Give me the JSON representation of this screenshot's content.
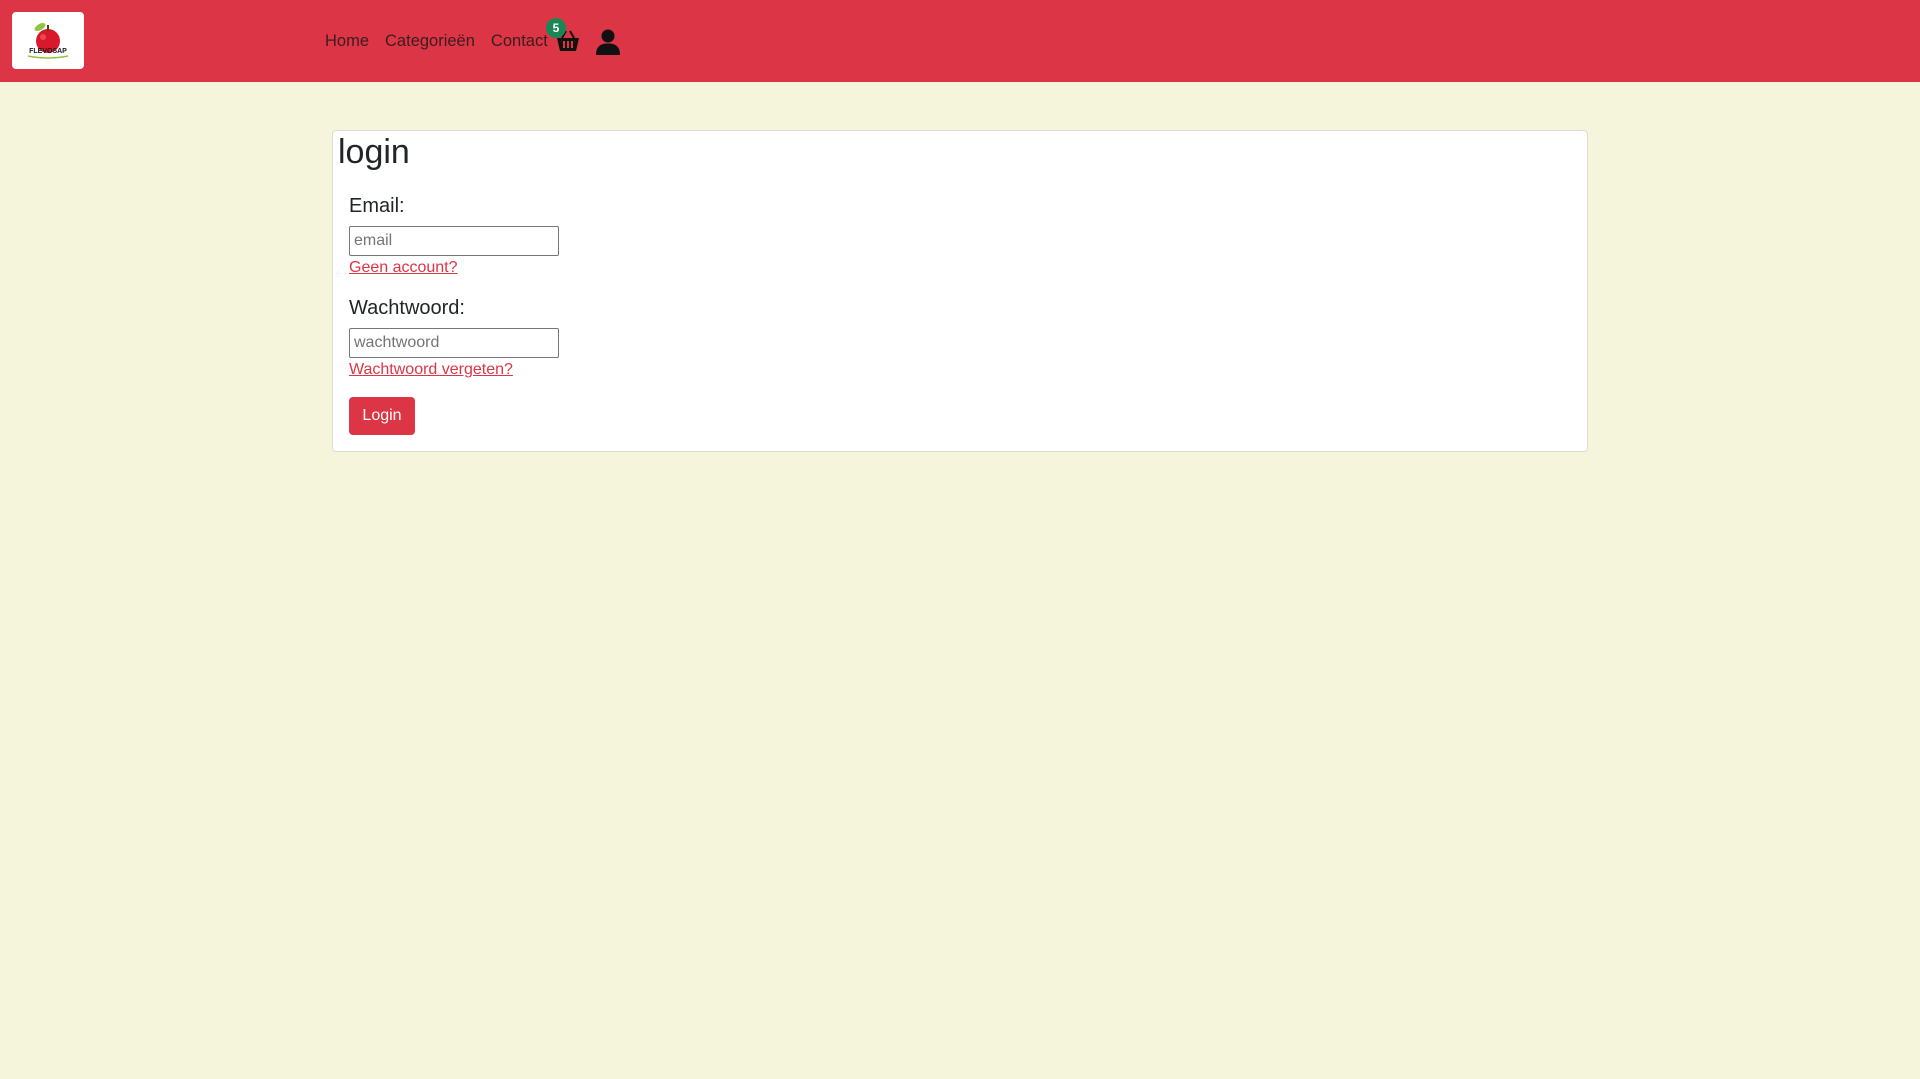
{
  "nav": {
    "logo_text": "FLEVOSAP",
    "links": [
      {
        "label": "Home"
      },
      {
        "label": "Categorieën"
      },
      {
        "label": "Contact"
      }
    ],
    "cart_count": "5",
    "cart_icon": "basket-icon",
    "user_icon": "user-icon"
  },
  "login": {
    "title": "login",
    "email_label": "Email:",
    "email_placeholder": "email",
    "email_value": "",
    "no_account_link": "Geen account?",
    "password_label": "Wachtwoord:",
    "password_placeholder": "wachtwoord",
    "password_value": "",
    "forgot_link": "Wachtwoord vergeten?",
    "submit_label": "Login"
  },
  "colors": {
    "navbar": "#dc3545",
    "page_background": "#f5f5dc",
    "badge": "#198754",
    "link": "#dc3545"
  }
}
